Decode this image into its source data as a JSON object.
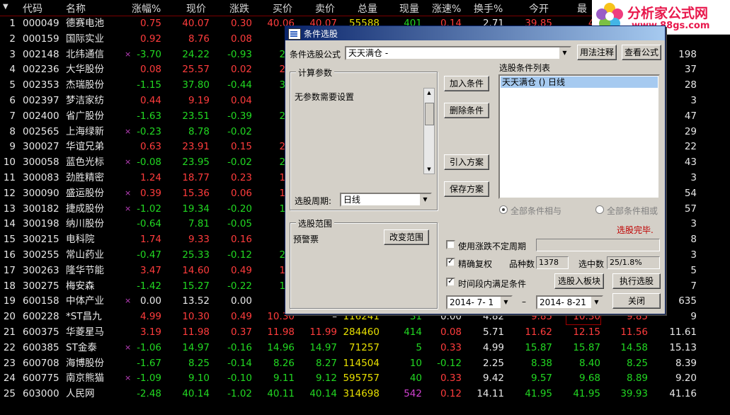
{
  "colors": {
    "background": "#000000",
    "up": "#ff3c3c",
    "down": "#22d822",
    "neutral": "#e8e8e8",
    "volume": "#e8e000",
    "title_blue": "#0a246a",
    "logo": "#e8184c"
  },
  "header": {
    "col0": "",
    "code": "代码",
    "name": "名称",
    "change_pct": "涨幅%",
    "price": "现价",
    "change": "涨跌",
    "bid": "买价",
    "ask": "卖价",
    "volume": "总量",
    "cur_vol": "现量",
    "speed": "涨速%",
    "turnover": "换手%",
    "open": "今开",
    "high": "最"
  },
  "rows": [
    {
      "idx": "1",
      "code": "000049",
      "name": "德赛电池",
      "mark": "",
      "chg_pct": "0.75",
      "price": "40.07",
      "chg": "0.30",
      "bid": "40.06",
      "ask": "40.07",
      "vol": "55588",
      "cur": "401",
      "speed": "0.14",
      "turn": "2.71",
      "open": "39.85",
      "high": "40",
      "c13": "",
      "c14": ""
    },
    {
      "idx": "2",
      "code": "000159",
      "name": "国际实业",
      "mark": "",
      "chg_pct": "0.92",
      "price": "8.76",
      "chg": "0.08",
      "bid": "8.",
      "ask": "",
      "vol": "",
      "cur": "",
      "speed": "",
      "turn": "",
      "open": "",
      "high": "",
      "c13": "",
      "c14": ""
    },
    {
      "idx": "3",
      "code": "002148",
      "name": "北纬通信",
      "mark": "×",
      "chg_pct": "-3.70",
      "price": "24.22",
      "chg": "-0.93",
      "bid": "24.",
      "ask": "",
      "vol": "",
      "cur": "",
      "speed": "",
      "turn": "",
      "open": "",
      "high": "",
      "c13": "25.15",
      "c14": "198"
    },
    {
      "idx": "4",
      "code": "002236",
      "name": "大华股份",
      "mark": "",
      "chg_pct": "0.08",
      "price": "25.57",
      "chg": "0.02",
      "bid": "25.",
      "ask": "",
      "vol": "",
      "cur": "",
      "speed": "",
      "turn": "",
      "open": "",
      "high": "",
      "c13": "25.55",
      "c14": "37"
    },
    {
      "idx": "5",
      "code": "002353",
      "name": "杰瑞股份",
      "mark": "",
      "chg_pct": "-1.15",
      "price": "37.80",
      "chg": "-0.44",
      "bid": "37.",
      "ask": "",
      "vol": "",
      "cur": "",
      "speed": "",
      "turn": "",
      "open": "",
      "high": "",
      "c13": "38.24",
      "c14": "28"
    },
    {
      "idx": "6",
      "code": "002397",
      "name": "梦洁家纺",
      "mark": "",
      "chg_pct": "0.44",
      "price": "9.19",
      "chg": "0.04",
      "bid": "9.",
      "ask": "",
      "vol": "",
      "cur": "",
      "speed": "",
      "turn": "",
      "open": "",
      "high": "",
      "c13": "9.15",
      "c14": "3"
    },
    {
      "idx": "7",
      "code": "002400",
      "name": "省广股份",
      "mark": "",
      "chg_pct": "-1.63",
      "price": "23.51",
      "chg": "-0.39",
      "bid": "23.",
      "ask": "",
      "vol": "",
      "cur": "",
      "speed": "",
      "turn": "",
      "open": "",
      "high": "",
      "c13": "23.90",
      "c14": "47"
    },
    {
      "idx": "8",
      "code": "002565",
      "name": "上海绿新",
      "mark": "×",
      "chg_pct": "-0.23",
      "price": "8.78",
      "chg": "-0.02",
      "bid": "8.",
      "ask": "",
      "vol": "",
      "cur": "",
      "speed": "",
      "turn": "",
      "open": "",
      "high": "",
      "c13": "8.80",
      "c14": "29"
    },
    {
      "idx": "9",
      "code": "300027",
      "name": "华谊兄弟",
      "mark": "",
      "chg_pct": "0.63",
      "price": "23.91",
      "chg": "0.15",
      "bid": "23.",
      "ask": "",
      "vol": "",
      "cur": "",
      "speed": "",
      "turn": "",
      "open": "",
      "high": "",
      "c13": "23.76",
      "c14": "22"
    },
    {
      "idx": "10",
      "code": "300058",
      "name": "蓝色光标",
      "mark": "×",
      "chg_pct": "-0.08",
      "price": "23.95",
      "chg": "-0.02",
      "bid": "23.",
      "ask": "",
      "vol": "",
      "cur": "",
      "speed": "",
      "turn": "",
      "open": "",
      "high": "",
      "c13": "23.97",
      "c14": "43"
    },
    {
      "idx": "11",
      "code": "300083",
      "name": "劲胜精密",
      "mark": "",
      "chg_pct": "1.24",
      "price": "18.77",
      "chg": "0.23",
      "bid": "18.",
      "ask": "",
      "vol": "",
      "cur": "",
      "speed": "",
      "turn": "",
      "open": "",
      "high": "",
      "c13": "18.54",
      "c14": "3"
    },
    {
      "idx": "12",
      "code": "300090",
      "name": "盛运股份",
      "mark": "×",
      "chg_pct": "0.39",
      "price": "15.36",
      "chg": "0.06",
      "bid": "15.",
      "ask": "",
      "vol": "",
      "cur": "",
      "speed": "",
      "turn": "",
      "open": "",
      "high": "",
      "c13": "15.30",
      "c14": "54"
    },
    {
      "idx": "13",
      "code": "300182",
      "name": "捷成股份",
      "mark": "×",
      "chg_pct": "-1.02",
      "price": "19.34",
      "chg": "-0.20",
      "bid": "19.",
      "ask": "",
      "vol": "",
      "cur": "",
      "speed": "",
      "turn": "",
      "open": "",
      "high": "",
      "c13": "19.54",
      "c14": "57"
    },
    {
      "idx": "14",
      "code": "300198",
      "name": "纳川股份",
      "mark": "",
      "chg_pct": "-0.64",
      "price": "7.81",
      "chg": "-0.05",
      "bid": "7.",
      "ask": "",
      "vol": "",
      "cur": "",
      "speed": "",
      "turn": "",
      "open": "",
      "high": "",
      "c13": "7.86",
      "c14": "3"
    },
    {
      "idx": "15",
      "code": "300215",
      "name": "电科院",
      "mark": "",
      "chg_pct": "1.74",
      "price": "9.33",
      "chg": "0.16",
      "bid": "9.",
      "ask": "",
      "vol": "",
      "cur": "",
      "speed": "",
      "turn": "",
      "open": "",
      "high": "",
      "c13": "9.17",
      "c14": "8"
    },
    {
      "idx": "16",
      "code": "300255",
      "name": "常山药业",
      "mark": "",
      "chg_pct": "-0.47",
      "price": "25.33",
      "chg": "-0.12",
      "bid": "25.",
      "ask": "",
      "vol": "",
      "cur": "",
      "speed": "",
      "turn": "",
      "open": "",
      "high": "",
      "c13": "25.45",
      "c14": "3"
    },
    {
      "idx": "17",
      "code": "300263",
      "name": "隆华节能",
      "mark": "",
      "chg_pct": "3.47",
      "price": "14.60",
      "chg": "0.49",
      "bid": "14.",
      "ask": "",
      "vol": "",
      "cur": "",
      "speed": "",
      "turn": "",
      "open": "",
      "high": "",
      "c13": "14.11",
      "c14": "5"
    },
    {
      "idx": "18",
      "code": "300275",
      "name": "梅安森",
      "mark": "",
      "chg_pct": "-1.42",
      "price": "15.27",
      "chg": "-0.22",
      "bid": "15.",
      "ask": "",
      "vol": "",
      "cur": "",
      "speed": "",
      "turn": "",
      "open": "",
      "high": "",
      "c13": "15.49",
      "c14": "7"
    },
    {
      "idx": "19",
      "code": "600158",
      "name": "中体产业",
      "mark": "×",
      "chg_pct": "0.00",
      "price": "13.52",
      "chg": "0.00",
      "bid": "",
      "ask": "",
      "vol": "",
      "cur": "",
      "speed": "",
      "turn": "",
      "open": "",
      "high": "",
      "c13": "13.52",
      "c14": "635"
    },
    {
      "idx": "20",
      "code": "600228",
      "name": "*ST昌九",
      "mark": "",
      "chg_pct": "4.99",
      "price": "10.30",
      "chg": "0.49",
      "bid": "10.30",
      "ask": "–",
      "vol": "116241",
      "cur": "31",
      "speed": "0.00",
      "turn": "4.82",
      "open": "9.85",
      "high": "10.30",
      "c13": "9.85",
      "c14": "9"
    },
    {
      "idx": "21",
      "code": "600375",
      "name": "华菱星马",
      "mark": "",
      "chg_pct": "3.19",
      "price": "11.98",
      "chg": "0.37",
      "bid": "11.98",
      "ask": "11.99",
      "vol": "284460",
      "cur": "414",
      "speed": "0.08",
      "turn": "5.71",
      "open": "11.62",
      "high": "12.15",
      "c13": "11.56",
      "c14": "11.61"
    },
    {
      "idx": "22",
      "code": "600385",
      "name": "ST金泰",
      "mark": "×",
      "chg_pct": "-1.06",
      "price": "14.97",
      "chg": "-0.16",
      "bid": "14.96",
      "ask": "14.97",
      "vol": "71257",
      "cur": "5",
      "speed": "0.33",
      "turn": "4.99",
      "open": "15.87",
      "high": "15.87",
      "c13": "14.58",
      "c14": "15.13"
    },
    {
      "idx": "23",
      "code": "600708",
      "name": "海博股份",
      "mark": "",
      "chg_pct": "-1.67",
      "price": "8.25",
      "chg": "-0.14",
      "bid": "8.26",
      "ask": "8.27",
      "vol": "114504",
      "cur": "10",
      "speed": "-0.12",
      "turn": "2.25",
      "open": "8.38",
      "high": "8.40",
      "c13": "8.25",
      "c14": "8.39"
    },
    {
      "idx": "24",
      "code": "600775",
      "name": "南京熊猫",
      "mark": "×",
      "chg_pct": "-1.09",
      "price": "9.10",
      "chg": "-0.10",
      "bid": "9.11",
      "ask": "9.12",
      "vol": "595757",
      "cur": "40",
      "speed": "0.33",
      "turn": "9.42",
      "open": "9.57",
      "high": "9.68",
      "c13": "8.89",
      "c14": "9.20"
    },
    {
      "idx": "25",
      "code": "603000",
      "name": "人民网",
      "mark": "",
      "chg_pct": "-2.48",
      "price": "40.14",
      "chg": "-1.02",
      "bid": "40.11",
      "ask": "40.14",
      "vol": "314698",
      "cur": "542",
      "speed": "0.12",
      "turn": "14.11",
      "open": "41.95",
      "high": "41.95",
      "c13": "39.93",
      "c14": "41.16"
    }
  ],
  "logo": {
    "title": "分析家公式网",
    "url": "www.88gs.com"
  },
  "dialog": {
    "title": "条件选股",
    "formula_label": "条件选股公式",
    "formula_value": "天天满仓 -",
    "usage_btn": "用法注释",
    "view_btn": "查看公式",
    "params_title": "计算参数",
    "params_text": "无参数需要设置",
    "period_label": "选股周期:",
    "period_value": "日线",
    "add_btn": "加入条件",
    "del_btn": "删除条件",
    "import_btn": "引入方案",
    "save_btn": "保存方案",
    "list_title": "选股条件列表",
    "list_item": "天天满仓  () 日线",
    "radio_and": "全部条件相与",
    "radio_or": "全部条件相或",
    "status": "选股完毕.",
    "range_title": "选股范围",
    "range_value": "预警票",
    "change_range_btn": "改变范围",
    "chk_variable": "使用涨跌不定周期",
    "chk_adjust": "精确复权",
    "count_label": "品种数",
    "count_value": "1378",
    "selected_label": "选中数",
    "selected_value": "25/1.8%",
    "chk_time": "时间段内满足条件",
    "to_block_btn": "选股入板块",
    "run_btn": "执行选股",
    "date_from": "2014- 7- 1",
    "date_sep": "–",
    "date_to": "2014- 8-21",
    "close_btn": "关闭"
  }
}
